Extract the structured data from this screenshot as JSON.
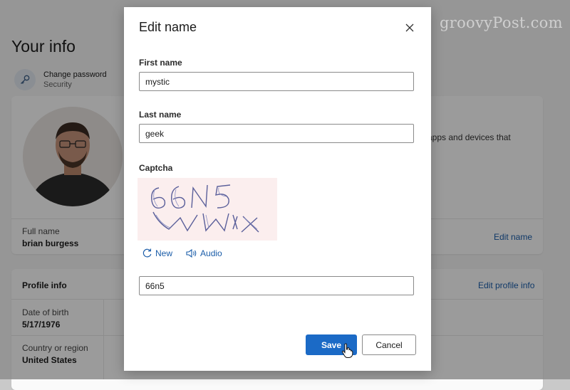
{
  "watermark": "groovyPost.com",
  "background": {
    "title": "Your info",
    "change_password": {
      "label": "Change password",
      "sublabel": "Security",
      "icon": "key-icon"
    },
    "description_fragment": "n apps and devices that",
    "full_name": {
      "label": "Full name",
      "value": "brian burgess",
      "link": "Edit name"
    },
    "profile_info": {
      "header": "Profile info",
      "link": "Edit profile info",
      "date_of_birth": {
        "label": "Date of birth",
        "value": "5/17/1976"
      },
      "country": {
        "label": "Country or region",
        "value": "United States"
      }
    }
  },
  "dialog": {
    "title": "Edit name",
    "close_icon": "close-icon",
    "first_name": {
      "label": "First name",
      "value": "mystic"
    },
    "last_name": {
      "label": "Last name",
      "value": "geek"
    },
    "captcha": {
      "label": "Captcha",
      "image_text": "66N5 WMX",
      "new_label": "New",
      "audio_label": "Audio",
      "input_value": "66n5"
    },
    "save_label": "Save",
    "cancel_label": "Cancel"
  },
  "colors": {
    "accent": "#1b6ac6",
    "link": "#1a5ca8"
  }
}
